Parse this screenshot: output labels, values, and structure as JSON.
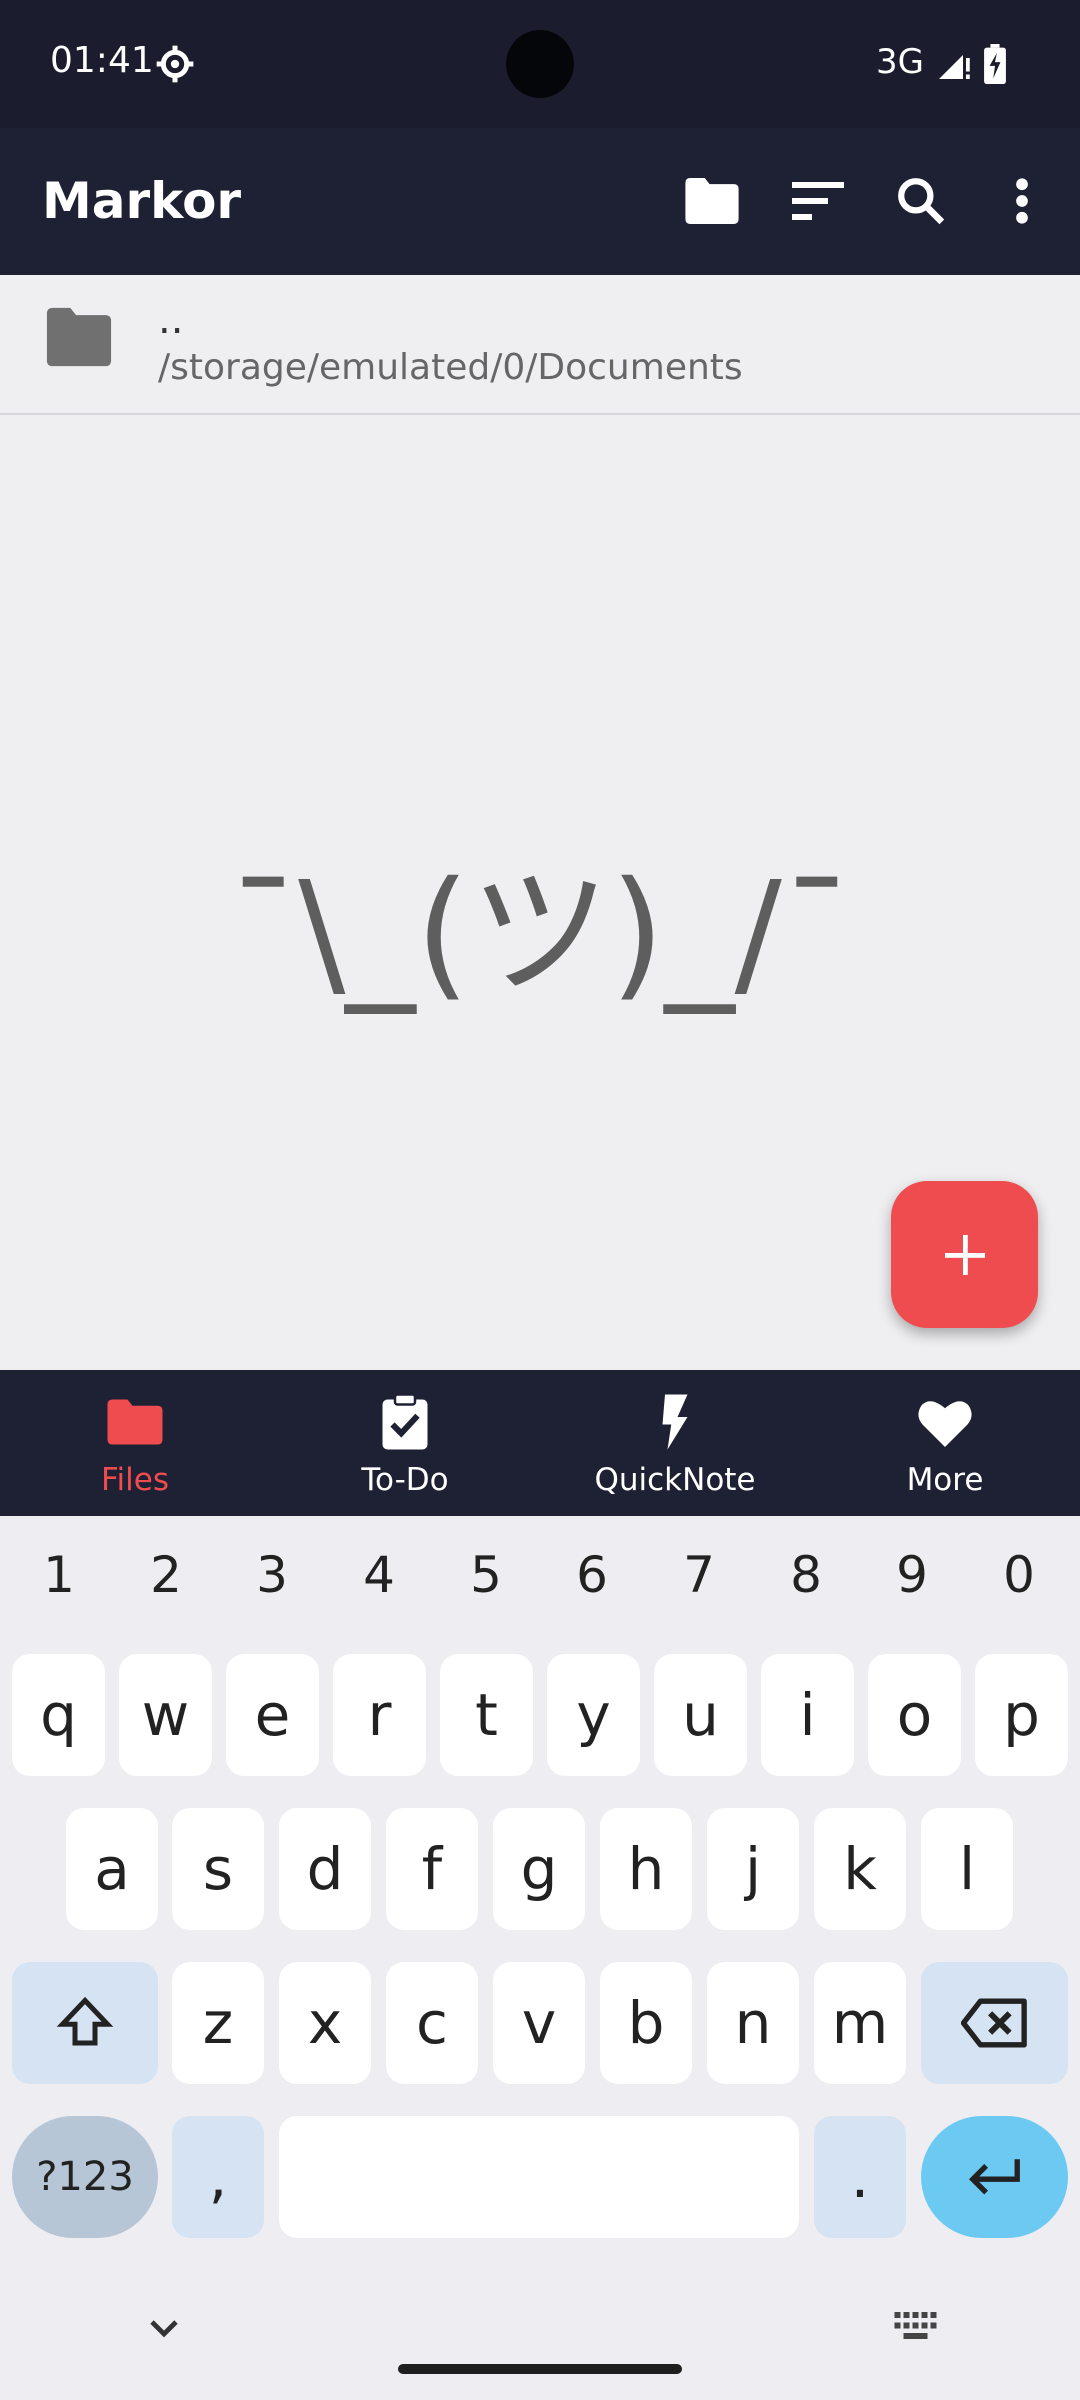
{
  "status_bar": {
    "time": "01:41",
    "network": "3G"
  },
  "app_bar": {
    "title": "Markor"
  },
  "file_list": {
    "items": [
      {
        "name": "..",
        "path": "/storage/emulated/0/Documents"
      }
    ],
    "empty_text": "¯\\_(ツ)_/¯"
  },
  "fab": {
    "label": "+"
  },
  "bottom_nav": {
    "items": [
      {
        "label": "Files",
        "active": true
      },
      {
        "label": "To-Do",
        "active": false
      },
      {
        "label": "QuickNote",
        "active": false
      },
      {
        "label": "More",
        "active": false
      }
    ]
  },
  "keyboard": {
    "numbers": [
      "1",
      "2",
      "3",
      "4",
      "5",
      "6",
      "7",
      "8",
      "9",
      "0"
    ],
    "row1": [
      "q",
      "w",
      "e",
      "r",
      "t",
      "y",
      "u",
      "i",
      "o",
      "p"
    ],
    "row2": [
      "a",
      "s",
      "d",
      "f",
      "g",
      "h",
      "j",
      "k",
      "l"
    ],
    "row3": [
      "z",
      "x",
      "c",
      "v",
      "b",
      "n",
      "m"
    ],
    "symbols_label": "?123",
    "comma": ",",
    "period": "."
  },
  "colors": {
    "accent": "#ee4c4e",
    "appbar": "#1e2133",
    "enter": "#6cc9f2"
  }
}
